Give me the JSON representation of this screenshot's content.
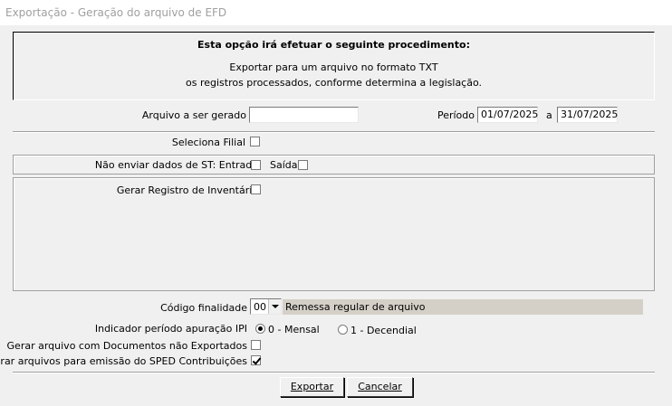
{
  "window": {
    "title": "Exportação - Geração do arquivo de EFD"
  },
  "info": {
    "heading": "Esta opção irá efetuar o seguinte procedimento:",
    "line1": "Exportar para um arquivo no formato TXT",
    "line2": "os registros processados, conforme determina a legislação."
  },
  "form": {
    "arquivo_label": "Arquivo a ser gerado",
    "arquivo_value": "",
    "periodo_label": "Período",
    "periodo_inicio": "01/07/2025",
    "periodo_sep": "a",
    "periodo_fim": "31/07/2025",
    "filial_label": "Seleciona Filial",
    "filial_checked": false,
    "st_label": "Não enviar dados de ST: Entrada",
    "st_entrada_checked": false,
    "st_saida_label": "Saída",
    "st_saida_checked": false,
    "inventario_label": "Gerar Registro de Inventário",
    "inventario_checked": false,
    "codigo_label": "Código finalidade",
    "codigo_value": "00",
    "codigo_desc": "Remessa regular de arquivo",
    "ipi_label": "Indicador período apuração IPI",
    "ipi_opt1": "0 - Mensal",
    "ipi_opt2": "1 - Decendial",
    "ipi_selected": "0",
    "nao_exportados_label": "Gerar arquivo com Documentos não Exportados",
    "nao_exportados_checked": false,
    "sped_label": "Gerar arquivos para emissão do SPED Contribuições",
    "sped_checked": true
  },
  "buttons": {
    "exportar": "Exportar",
    "cancelar": "Cancelar"
  }
}
